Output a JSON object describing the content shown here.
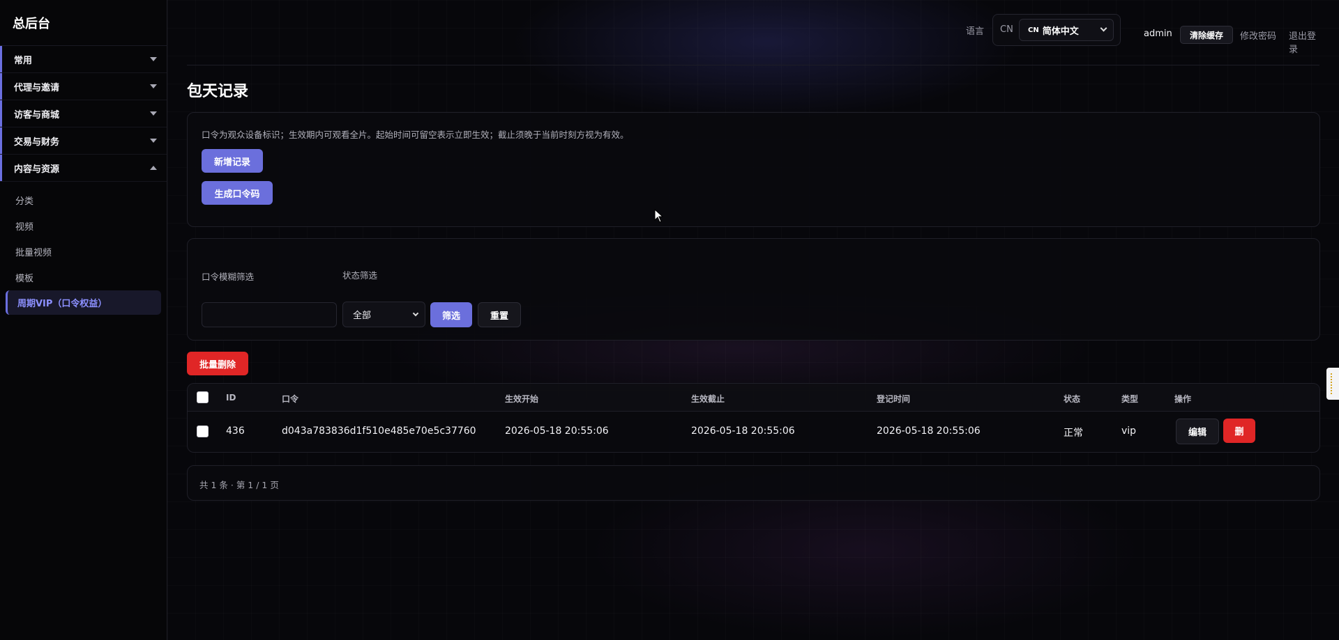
{
  "sidebar": {
    "brand": "总后台",
    "groups": [
      {
        "label": "常用"
      },
      {
        "label": "代理与邀请"
      },
      {
        "label": "访客与商城"
      },
      {
        "label": "交易与财务"
      },
      {
        "label": "内容与资源"
      }
    ],
    "sub_items": [
      {
        "label": "分类"
      },
      {
        "label": "视频"
      },
      {
        "label": "批量视频"
      },
      {
        "label": "模板"
      },
      {
        "label": "周期VIP（口令权益）"
      }
    ]
  },
  "topbar": {
    "lang_label": "语言",
    "lang_code": "CN",
    "lang_select_flag": "CN",
    "lang_select_value": "简体中文",
    "username": "admin",
    "clear_cache": "清除缓存",
    "change_password": "修改密码",
    "logout": "退出登录"
  },
  "page": {
    "title": "包天记录",
    "hint": "口令为观众设备标识；生效期内可观看全片。起始时间可留空表示立即生效；截止须晚于当前时刻方视为有效。",
    "add_record": "新增记录",
    "generate_code": "生成口令码"
  },
  "filters": {
    "code_label": "口令模糊筛选",
    "status_label": "状态筛选",
    "code_value": "",
    "status_value": "全部",
    "filter_button": "筛选",
    "reset_button": "重置"
  },
  "batch_delete": "批量删除",
  "table": {
    "headers": [
      "ID",
      "口令",
      "生效开始",
      "生效截止",
      "登记时间",
      "状态",
      "类型",
      "操作"
    ],
    "rows": [
      {
        "id": "436",
        "code": "d043a783836d1f510e485e70e5c37760",
        "start": "2026-05-18 20:55:06",
        "end": "2026-05-18 20:55:06",
        "registered": "2026-05-18 20:55:06",
        "status": "正常",
        "type": "vip",
        "edit": "编辑",
        "delete": "删"
      }
    ]
  },
  "pager": {
    "summary": "共 1 条 · 第 1 / 1 页"
  },
  "colors": {
    "accent": "#6b6fdc",
    "danger": "#e02626",
    "background": "#07070b"
  }
}
